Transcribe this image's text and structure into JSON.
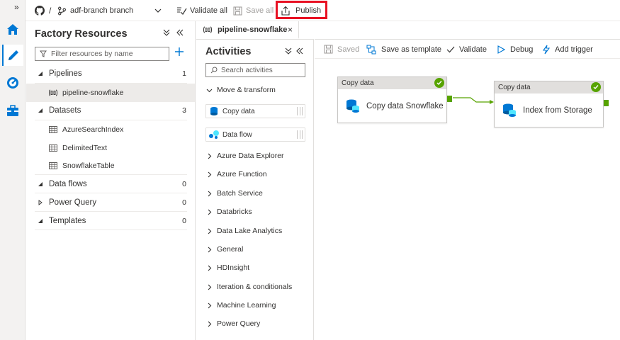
{
  "topbar": {
    "repo_separator": "/",
    "branch_name": "adf-branch branch",
    "validate_all": "Validate all",
    "save_all": "Save all",
    "publish": "Publish"
  },
  "rail": {
    "collapse_glyph": "»",
    "items": [
      {
        "name": "home-icon"
      },
      {
        "name": "author-pencil-icon"
      },
      {
        "name": "monitor-icon"
      },
      {
        "name": "manage-toolbox-icon"
      }
    ]
  },
  "resources": {
    "title": "Factory Resources",
    "filter_placeholder": "Filter resources by name",
    "pipelines_label": "Pipelines",
    "pipelines_count": "1",
    "pipeline_item": "pipeline-snowflake",
    "datasets_label": "Datasets",
    "datasets_count": "3",
    "datasets": [
      "AzureSearchIndex",
      "DelimitedText",
      "SnowflakeTable"
    ],
    "dataflows_label": "Data flows",
    "dataflows_count": "0",
    "powerquery_label": "Power Query",
    "powerquery_count": "0",
    "templates_label": "Templates",
    "templates_count": "0"
  },
  "tab": {
    "label": "pipeline-snowflake",
    "close": "×"
  },
  "activities": {
    "title": "Activities",
    "search_placeholder": "Search activities",
    "move_transform": "Move & transform",
    "copy_data": "Copy data",
    "data_flow": "Data flow",
    "categories": [
      "Azure Data Explorer",
      "Azure Function",
      "Batch Service",
      "Databricks",
      "Data Lake Analytics",
      "General",
      "HDInsight",
      "Iteration & conditionals",
      "Machine Learning",
      "Power Query"
    ]
  },
  "canvas_toolbar": {
    "saved": "Saved",
    "save_as_template": "Save as template",
    "validate": "Validate",
    "debug": "Debug",
    "add_trigger": "Add trigger"
  },
  "canvas": {
    "node1_type": "Copy data",
    "node1_name": "Copy data Snowflake",
    "node2_type": "Copy data",
    "node2_name": "Index from Storage"
  },
  "colors": {
    "accent": "#0078d4",
    "success": "#57a300",
    "highlight": "#e81123"
  }
}
